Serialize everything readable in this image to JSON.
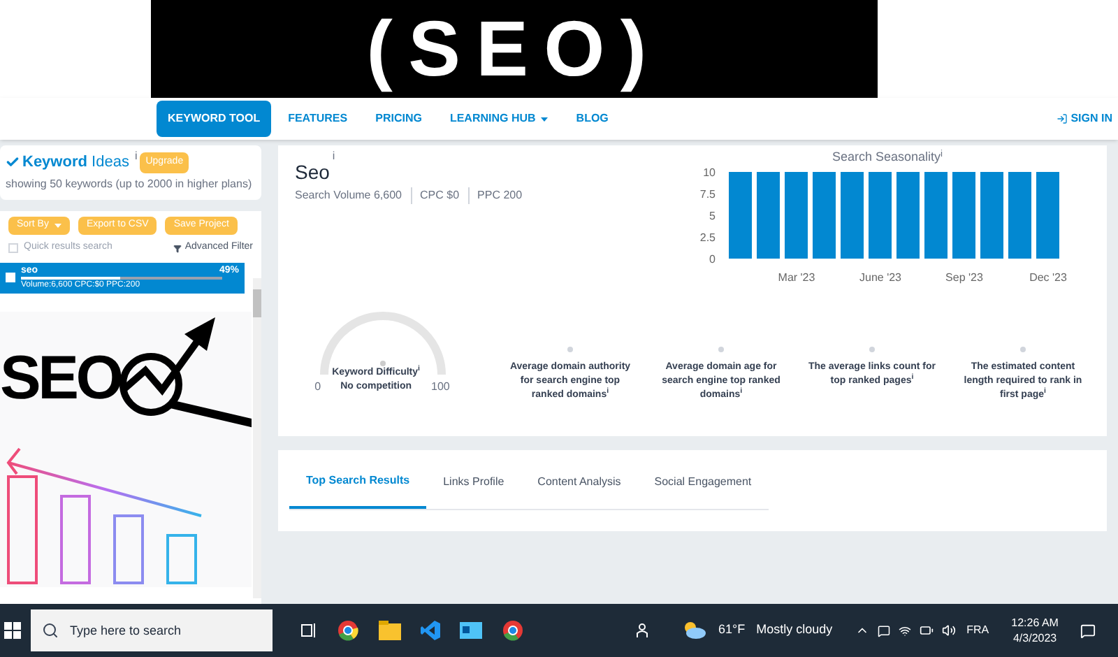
{
  "banner": {
    "title": "(SEO)"
  },
  "nav": {
    "items": [
      {
        "label": "KEYWORD TOOL",
        "selected": true,
        "caret": false
      },
      {
        "label": "FEATURES",
        "selected": false,
        "caret": false
      },
      {
        "label": "PRICING",
        "selected": false,
        "caret": false
      },
      {
        "label": "LEARNING HUB",
        "selected": false,
        "caret": true
      },
      {
        "label": "BLOG",
        "selected": false,
        "caret": false
      }
    ],
    "sign_in": "SIGN IN"
  },
  "ideas": {
    "title_bold": "Keyword",
    "title_rest": "Ideas",
    "info": "i",
    "badge": "Upgrade",
    "subtitle": "showing 50 keywords (up to 2000 in higher plans)"
  },
  "actions": [
    {
      "label": "Sort By",
      "caret": true
    },
    {
      "label": "Export to CSV",
      "caret": false
    },
    {
      "label": "Save Project",
      "caret": false
    }
  ],
  "quick_search": {
    "placeholder": "Quick results search",
    "checked": false
  },
  "advanced_filter": "Advanced Filter",
  "keywords": [
    {
      "name": "seo",
      "percent": "49%",
      "level": 0.49,
      "details": "Volume:6,600  CPC:$0  PPC:200",
      "selected": true,
      "checked": false
    }
  ],
  "overlay": {
    "logo": "SEO"
  },
  "keyword": {
    "title": "Seo",
    "info": "i",
    "stats": [
      "Search Volume 6,600",
      "CPC $0",
      "PPC 200"
    ]
  },
  "difficulty": {
    "min": "0",
    "max": "100",
    "label": "Keyword Difficulty",
    "info": "i",
    "value": "No competition",
    "level": 0
  },
  "chart": {
    "chart_data": {
      "type": "bar",
      "title": "Search Seasonality",
      "categories": [
        null,
        null,
        "Mar '23",
        null,
        null,
        "June '23",
        null,
        null,
        "Sep '23",
        null,
        null,
        "Dec '23"
      ],
      "values": [
        10,
        10,
        10,
        10,
        10,
        10,
        10,
        10,
        10,
        10,
        10,
        10
      ],
      "ylim": [
        0,
        10
      ],
      "yticks": [
        0,
        2.5,
        5,
        7.5,
        10
      ]
    },
    "info": "i"
  },
  "metrics": [
    {
      "label": "Average domain authority for search engine top ranked domains",
      "info": "i"
    },
    {
      "label": "Average domain age for search engine top ranked domains",
      "info": "i"
    },
    {
      "label": "The average links count for top ranked pages",
      "info": "i"
    },
    {
      "label": "The estimated content length required to rank in first page",
      "info": "i"
    }
  ],
  "tabs": [
    {
      "label": "Top Search Results",
      "selected": true
    },
    {
      "label": "Links Profile",
      "selected": false
    },
    {
      "label": "Content Analysis",
      "selected": false
    },
    {
      "label": "Social Engagement",
      "selected": false
    }
  ],
  "taskbar": {
    "search_placeholder": "Type here to search",
    "temperature": "61°F",
    "weather": "Mostly cloudy",
    "language": "FRA",
    "time": "12:26 AM",
    "date": "4/3/2023"
  }
}
